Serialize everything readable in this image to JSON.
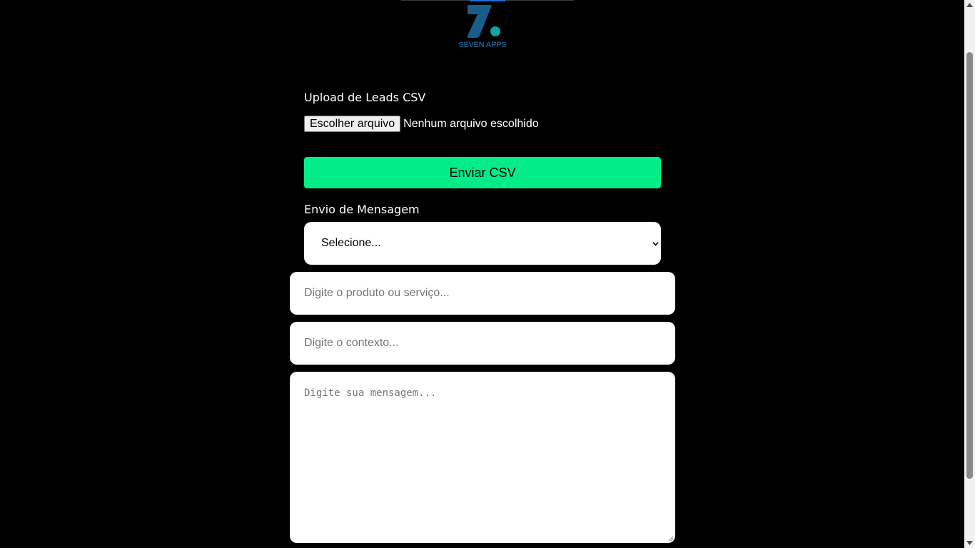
{
  "brand": {
    "name": "SEVEN APPS",
    "logo_color": "#1a5d8a",
    "dot_color": "#0fa3a3"
  },
  "upload": {
    "title": "Upload de Leads CSV",
    "choose_file_label": "Escolher arquivo",
    "file_status": "Nenhum arquivo escolhido",
    "submit_label": "Enviar CSV",
    "submit_color": "#02ec88"
  },
  "message": {
    "title": "Envio de Mensagem",
    "select_value": "Selecione...",
    "product_placeholder": "Digite o produto ou serviço...",
    "context_placeholder": "Digite o contexto...",
    "message_placeholder": "Digite sua mensagem..."
  },
  "icons": {
    "select": "chevron-down-icon",
    "scroll_up": "arrow-up-icon",
    "scroll_down": "arrow-down-icon"
  }
}
